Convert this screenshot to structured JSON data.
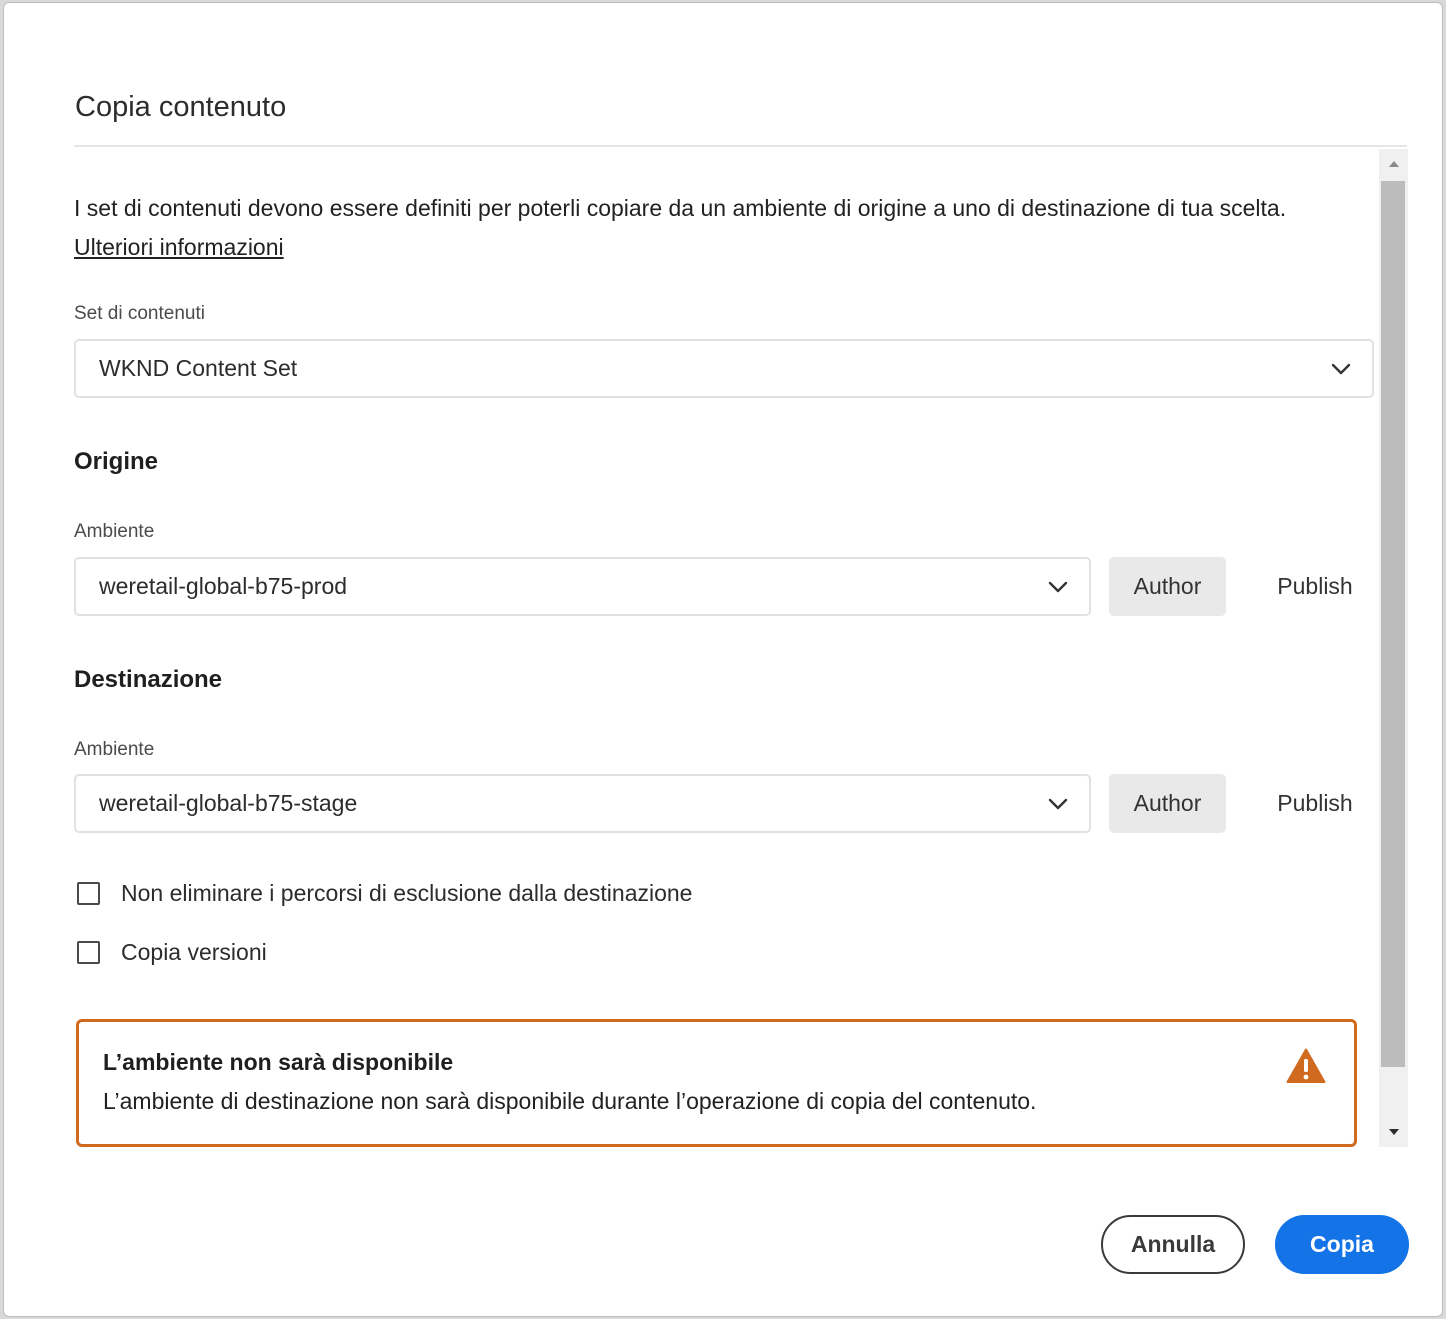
{
  "dialog": {
    "title": "Copia contenuto",
    "intro_text": "I set di contenuti devono essere definiti per poterli copiare da un ambiente di origine a uno di destinazione di tua scelta.",
    "learn_more_link": "Ulteriori informazioni"
  },
  "content_set": {
    "label": "Set di contenuti",
    "selected": "WKND Content Set"
  },
  "origin": {
    "section_title": "Origine",
    "env_label": "Ambiente",
    "env_selected": "weretail-global-b75-prod",
    "author_label": "Author",
    "publish_label": "Publish",
    "selected_tier": "Author"
  },
  "destination": {
    "section_title": "Destinazione",
    "env_label": "Ambiente",
    "env_selected": "weretail-global-b75-stage",
    "author_label": "Author",
    "publish_label": "Publish",
    "selected_tier": "Author"
  },
  "options": {
    "keep_exclusions_label": "Non eliminare i percorsi di esclusione dalla destinazione",
    "keep_exclusions_checked": false,
    "copy_versions_label": "Copia versioni",
    "copy_versions_checked": false
  },
  "warning": {
    "title": "L’ambiente non sarà disponibile",
    "text": "L’ambiente di destinazione non sarà disponibile durante l’operazione di copia del contenuto.",
    "icon": "alert-triangle-icon",
    "color": "#cf6a1f"
  },
  "footer": {
    "cancel_label": "Annulla",
    "copy_label": "Copia"
  },
  "colors": {
    "primary": "#1473e6",
    "warning": "#cf6a1f"
  }
}
